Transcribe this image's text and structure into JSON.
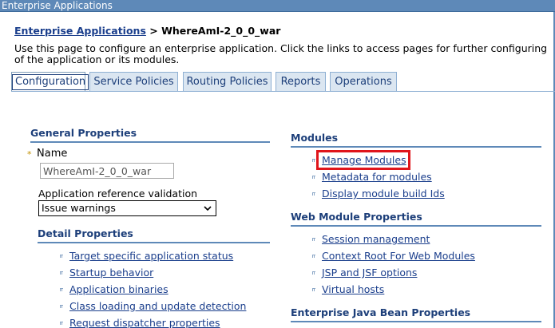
{
  "window": {
    "title": "Enterprise Applications"
  },
  "breadcrumb": {
    "link": "Enterprise Applications",
    "separator": " > ",
    "current": "WhereAmI-2_0_0_war"
  },
  "description": "Use this page to configure an enterprise application. Click the links to access pages for further configuring of the application or its modules.",
  "tabs": [
    {
      "label": "Configuration",
      "active": true
    },
    {
      "label": "Service Policies",
      "active": false
    },
    {
      "label": "Routing Policies",
      "active": false
    },
    {
      "label": "Reports",
      "active": false
    },
    {
      "label": "Operations",
      "active": false
    }
  ],
  "general": {
    "heading": "General Properties",
    "required_marker": "*",
    "name_label": "Name",
    "name_value": "WhereAmI-2_0_0_war",
    "arv_label": "Application reference validation",
    "arv_value": "Issue warnings"
  },
  "detail": {
    "heading": "Detail Properties",
    "items": [
      "Target specific application status",
      "Startup behavior",
      "Application binaries",
      "Class loading and update detection",
      "Request dispatcher properties"
    ]
  },
  "modules": {
    "heading": "Modules",
    "items": [
      "Manage Modules",
      "Metadata for modules",
      "Display module build Ids"
    ],
    "highlighted_item": "Manage Modules",
    "highlight_color": "#e0151b"
  },
  "web_module": {
    "heading": "Web Module Properties",
    "items": [
      "Session management",
      "Context Root For Web Modules",
      "JSP and JSF options",
      "Virtual hosts"
    ]
  },
  "ejb": {
    "heading": "Enterprise Java Bean Properties"
  },
  "colors": {
    "link": "#1a3e8c",
    "heading": "#1d3f7a",
    "rule": "#5e89b8",
    "tab_bg": "#dbe6f1"
  }
}
